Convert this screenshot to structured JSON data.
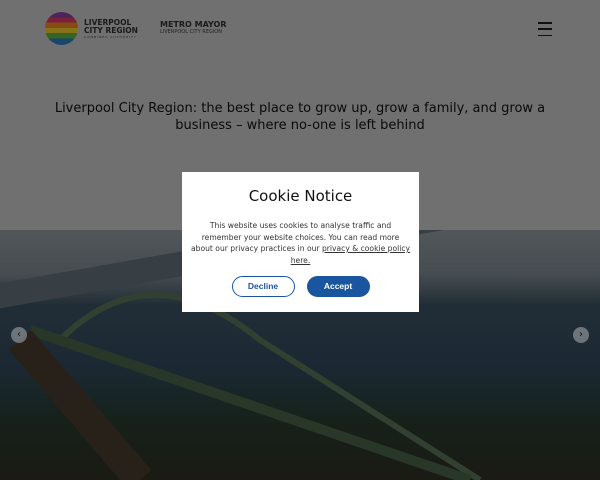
{
  "header": {
    "logo_line1": "LIVERPOOL",
    "logo_line2": "CITY REGION",
    "logo_sub": "COMBINED AUTHORITY",
    "metro_title": "METRO MAYOR",
    "metro_sub": "LIVERPOOL CITY REGION",
    "menu_icon": "hamburger-icon"
  },
  "hero": {
    "headline": "Liverpool City Region: the best place to grow up, grow a family, and grow a business – where no-one is left behind"
  },
  "carousel": {
    "prev": "‹",
    "next": "›"
  },
  "cookie": {
    "title": "Cookie Notice",
    "body": "This website uses cookies to analyse traffic and remember your website choices. You can read more about our privacy practices in our ",
    "link": "privacy & cookie policy here.",
    "decline": "Decline",
    "accept": "Accept"
  },
  "colors": {
    "accent": "#1a56a0"
  }
}
